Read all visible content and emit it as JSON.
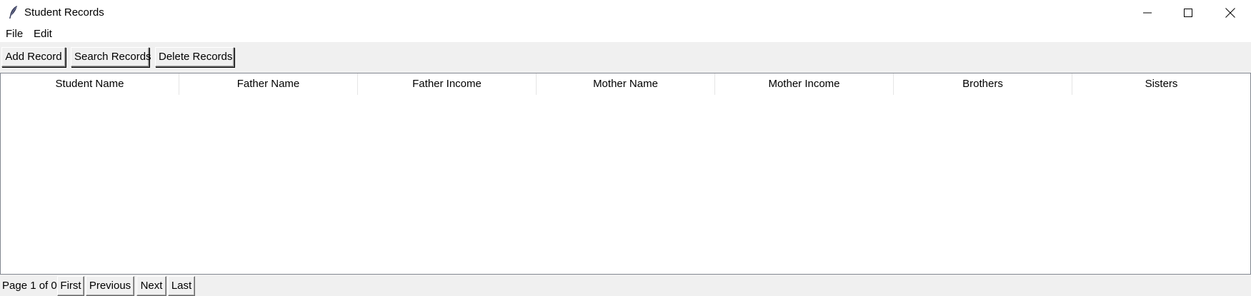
{
  "window": {
    "title": "Student Records",
    "icon": "feather-icon",
    "controls": [
      "minimize-icon",
      "maximize-icon",
      "close-icon"
    ]
  },
  "menu": {
    "file_label": "File",
    "edit_label": "Edit"
  },
  "toolbar": {
    "add_label": "Add Record",
    "search_label": "Search Records",
    "delete_label": "Delete Records"
  },
  "table": {
    "columns": [
      "Student Name",
      "Father Name",
      "Father Income",
      "Mother Name",
      "Mother Income",
      "Brothers",
      "Sisters"
    ],
    "rows": []
  },
  "pager": {
    "page_text": "Page 1 of 0",
    "first_label": "First",
    "previous_label": "Previous",
    "next_label": "Next",
    "last_label": "Last"
  }
}
